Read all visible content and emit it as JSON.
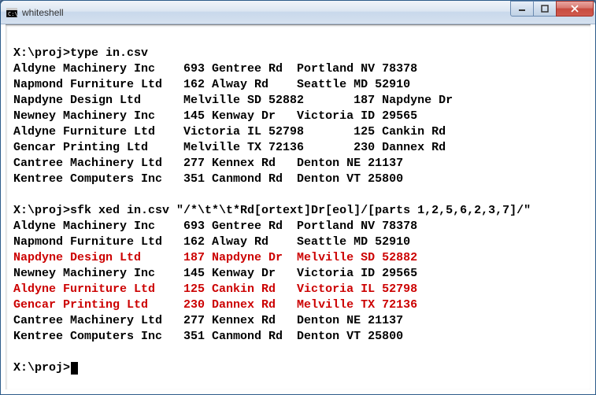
{
  "window": {
    "title": "whiteshell"
  },
  "terminal": {
    "prompt1": "X:\\proj>",
    "cmd1": "type in.csv",
    "file_lines": [
      "Aldyne Machinery Inc    693 Gentree Rd  Portland NV 78378",
      "Napmond Furniture Ltd   162 Alway Rd    Seattle MD 52910",
      "Napdyne Design Ltd      Melville SD 52882       187 Napdyne Dr",
      "Newney Machinery Inc    145 Kenway Dr   Victoria ID 29565",
      "Aldyne Furniture Ltd    Victoria IL 52798       125 Cankin Rd",
      "Gencar Printing Ltd     Melville TX 72136       230 Dannex Rd",
      "Cantree Machinery Ltd   277 Kennex Rd   Denton NE 21137",
      "Kentree Computers Inc   351 Canmond Rd  Denton VT 25800"
    ],
    "prompt2": "X:\\proj>",
    "cmd2": "sfk xed in.csv \"/*\\t*\\t*Rd[ortext]Dr[eol]/[parts 1,2,5,6,2,3,7]/\"",
    "out_lines": [
      {
        "text": "Aldyne Machinery Inc    693 Gentree Rd  Portland NV 78378",
        "red": false
      },
      {
        "text": "Napmond Furniture Ltd   162 Alway Rd    Seattle MD 52910",
        "red": false
      },
      {
        "text": "Napdyne Design Ltd      187 Napdyne Dr  Melville SD 52882",
        "red": true
      },
      {
        "text": "Newney Machinery Inc    145 Kenway Dr   Victoria ID 29565",
        "red": false
      },
      {
        "text": "Aldyne Furniture Ltd    125 Cankin Rd   Victoria IL 52798",
        "red": true
      },
      {
        "text": "Gencar Printing Ltd     230 Dannex Rd   Melville TX 72136",
        "red": true
      },
      {
        "text": "Cantree Machinery Ltd   277 Kennex Rd   Denton NE 21137",
        "red": false
      },
      {
        "text": "Kentree Computers Inc   351 Canmond Rd  Denton VT 25800",
        "red": false
      }
    ],
    "prompt3": "X:\\proj>"
  }
}
